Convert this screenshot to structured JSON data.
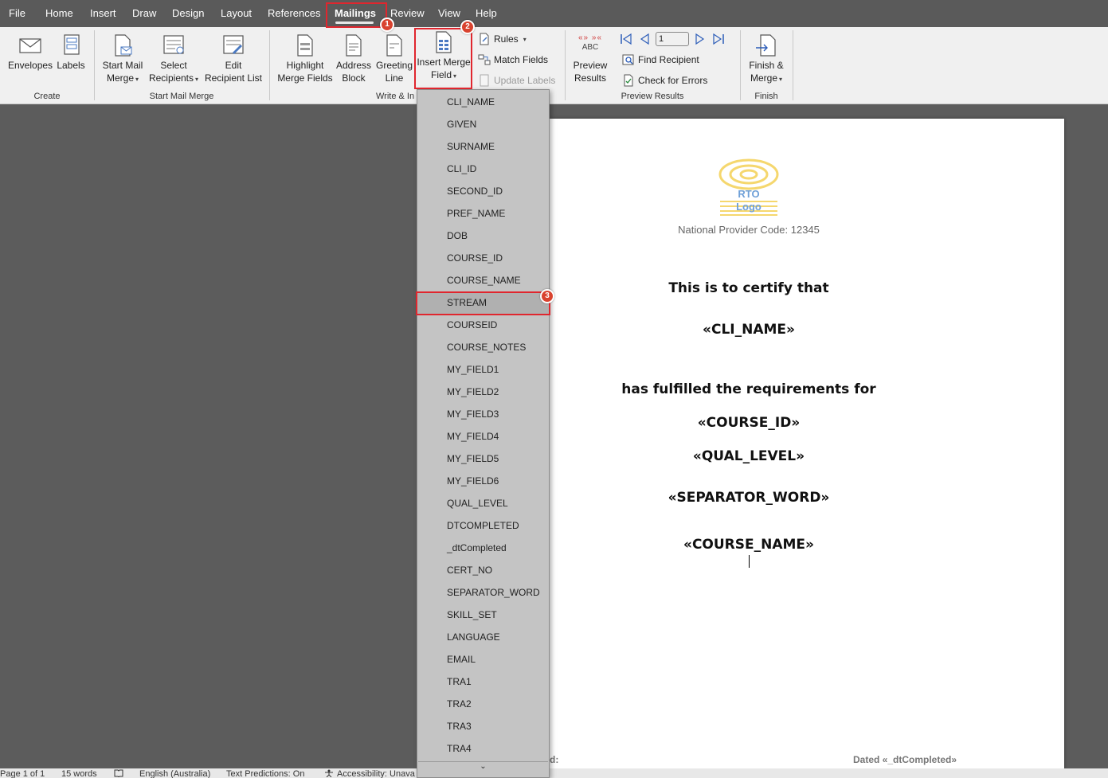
{
  "menubar": {
    "items": [
      "File",
      "Home",
      "Insert",
      "Draw",
      "Design",
      "Layout",
      "References",
      "Mailings",
      "Review",
      "View",
      "Help"
    ],
    "active": "Mailings"
  },
  "ribbon": {
    "create": {
      "envelopes": "Envelopes",
      "labels": "Labels",
      "group": "Create"
    },
    "start": {
      "start_mail_merge_1": "Start Mail",
      "start_mail_merge_2": "Merge",
      "select_recipients_1": "Select",
      "select_recipients_2": "Recipients",
      "edit_list_1": "Edit",
      "edit_list_2": "Recipient List",
      "group": "Start Mail Merge"
    },
    "write": {
      "highlight_1": "Highlight",
      "highlight_2": "Merge Fields",
      "address_1": "Address",
      "address_2": "Block",
      "greeting_1": "Greeting",
      "greeting_2": "Line",
      "insert_1": "Insert Merge",
      "insert_2": "Field",
      "rules": "Rules",
      "match_fields": "Match Fields",
      "update_labels": "Update Labels",
      "group": "Write & In"
    },
    "preview": {
      "abc": "ABC",
      "preview_1": "Preview",
      "preview_2": "Results",
      "record": "1",
      "find_recipient": "Find Recipient",
      "check_errors": "Check for Errors",
      "group": "Preview Results"
    },
    "finish": {
      "finish_1": "Finish &",
      "finish_2": "Merge",
      "group": "Finish"
    }
  },
  "dropdown": {
    "items": [
      "CLI_NAME",
      "GIVEN",
      "SURNAME",
      "CLI_ID",
      "SECOND_ID",
      "PREF_NAME",
      "DOB",
      "COURSE_ID",
      "COURSE_NAME",
      "STREAM",
      "COURSEID",
      "COURSE_NOTES",
      "MY_FIELD1",
      "MY_FIELD2",
      "MY_FIELD3",
      "MY_FIELD4",
      "MY_FIELD5",
      "MY_FIELD6",
      "QUAL_LEVEL",
      "DTCOMPLETED",
      "_dtCompleted",
      "CERT_NO",
      "SEPARATOR_WORD",
      "SKILL_SET",
      "LANGUAGE",
      "EMAIL",
      "TRA1",
      "TRA2",
      "TRA3",
      "TRA4"
    ],
    "highlighted": "STREAM",
    "scroll_glyph": "⌄"
  },
  "document": {
    "logo_line1": "RTO",
    "logo_line2": "Logo",
    "provider_code": "National Provider Code: 12345",
    "certify": "This is to certify that",
    "cli_name": "«CLI_NAME»",
    "fulfilled": "has fulfilled the requirements for",
    "course_id": "«COURSE_ID»",
    "qual_level": "«QUAL_LEVEL»",
    "separator": "«SEPARATOR_WORD»",
    "course_name": "«COURSE_NAME»",
    "footer_left": "d:",
    "footer_right": "Dated «_dtCompleted»"
  },
  "statusbar": {
    "page": "Page 1 of 1",
    "words": "15 words",
    "language": "English (Australia)",
    "predictions": "Text Predictions: On",
    "accessibility": "Accessibility: Unava"
  },
  "badges": [
    "1",
    "2",
    "3"
  ],
  "colors": {
    "highlight": "#e0262e",
    "badge": "#d9432f",
    "logo": "#f5d76e",
    "logo_text": "#6fa0d8"
  }
}
